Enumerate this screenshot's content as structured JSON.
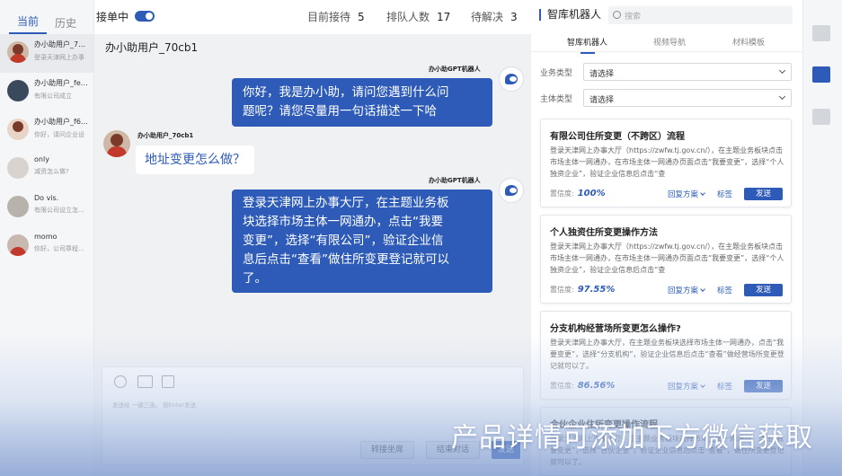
{
  "sessions": {
    "tabs": [
      {
        "label": "当前"
      },
      {
        "label": "历史"
      }
    ],
    "items": [
      {
        "name": "办小助用户_7…",
        "preview": "登录天津网上办事"
      },
      {
        "name": "办小助用户_fe…",
        "preview": "有限公司成立"
      },
      {
        "name": "办小助用户_f6…",
        "preview": "你好，请问企业设"
      },
      {
        "name": "only",
        "preview": "减资怎么做?"
      },
      {
        "name": "Do vis.",
        "preview": "有限公司设立怎…"
      },
      {
        "name": "momo",
        "preview": "你好，公司章程…"
      }
    ]
  },
  "topbar": {
    "receiving_label": "接单中",
    "stats": [
      {
        "label": "目前接待",
        "value": "5"
      },
      {
        "label": "排队人数",
        "value": "17"
      },
      {
        "label": "待解决",
        "value": "3"
      }
    ]
  },
  "chat": {
    "title": "办小助用户_70cb1",
    "messages": [
      {
        "sender": "办小助GPT机器人",
        "text_lines": [
          "你好，我是办小助，请问您遇到什么问",
          "题呢？请您尽量用一句话描述一下哈"
        ]
      },
      {
        "sender": "办小助用户_70cb1",
        "text": "地址变更怎么做？"
      },
      {
        "sender": "办小助GPT机器人",
        "text_lines": [
          "登录天津网上办事大厅，在主题业务板",
          "块选择市场主体一网通办，点击“我要",
          "变更”，选择“有限公司”，验证企业信",
          "息后点击“查看”做住所变更登记就可以",
          "了。"
        ]
      }
    ],
    "input_hint": "发送给 一键三连。 按Enter发送",
    "transfer_button": "转接坐席",
    "end_button": "结束对话",
    "send_button": "发送"
  },
  "panel": {
    "title": "智库机器人",
    "search_placeholder": "搜索",
    "tabs": [
      {
        "label": "智库机器人"
      },
      {
        "label": "视频导航"
      },
      {
        "label": "材料模板"
      }
    ],
    "filters": [
      {
        "label": "业务类型",
        "value": "请选择"
      },
      {
        "label": "主体类型",
        "value": "请选择"
      }
    ],
    "cards": [
      {
        "title": "有限公司住所变更（不跨区）流程",
        "body": "登录天津网上办事大厅（https://zwfw.tj.gov.cn/），在主题业务板块点击市场主体一网通办，在市场主体一网通办页面点击“我要变更”，选择“个人独资企业”，验证企业信息后点击“查",
        "confidence_label": "置信度:",
        "confidence": "100%",
        "plan_label": "回复方案",
        "tag_label": "标签",
        "send_label": "发送"
      },
      {
        "title": "个人独资住所变更操作方法",
        "body": "登录天津网上办事大厅（https://zwfw.tj.gov.cn/），在主题业务板块点击市场主体一网通办，在市场主体一网通办页面点击“我要变更”，选择“个人独资企业”，验证企业信息后点击“查",
        "confidence_label": "置信度:",
        "confidence": "97.55%",
        "plan_label": "回复方案",
        "tag_label": "标签",
        "send_label": "发送"
      },
      {
        "title": "分支机构经营场所变更怎么操作?",
        "body": "登录天津网上办事大厅，在主题业务板块选择市场主体一网通办，点击“我要变更”，选择“分支机构”，验证企业信息后点击“查看”做经营场所变更登记就可以了。",
        "confidence_label": "置信度:",
        "confidence": "86.56%",
        "plan_label": "回复方案",
        "tag_label": "标签",
        "send_label": "发送"
      },
      {
        "title": "合伙企业住所变更操作流程",
        "body": "登录天津网上办事大厅，在主题业务板块选择市场主体一网通办，点击“我要变更”，选择“合伙企业”，验证企业信息后点击“查看”，做住所变更登记就可以了。"
      }
    ]
  },
  "overlay": {
    "banner": "产品详情可添加下方微信获取"
  },
  "colors": {
    "accent": "#2d5bb7"
  }
}
